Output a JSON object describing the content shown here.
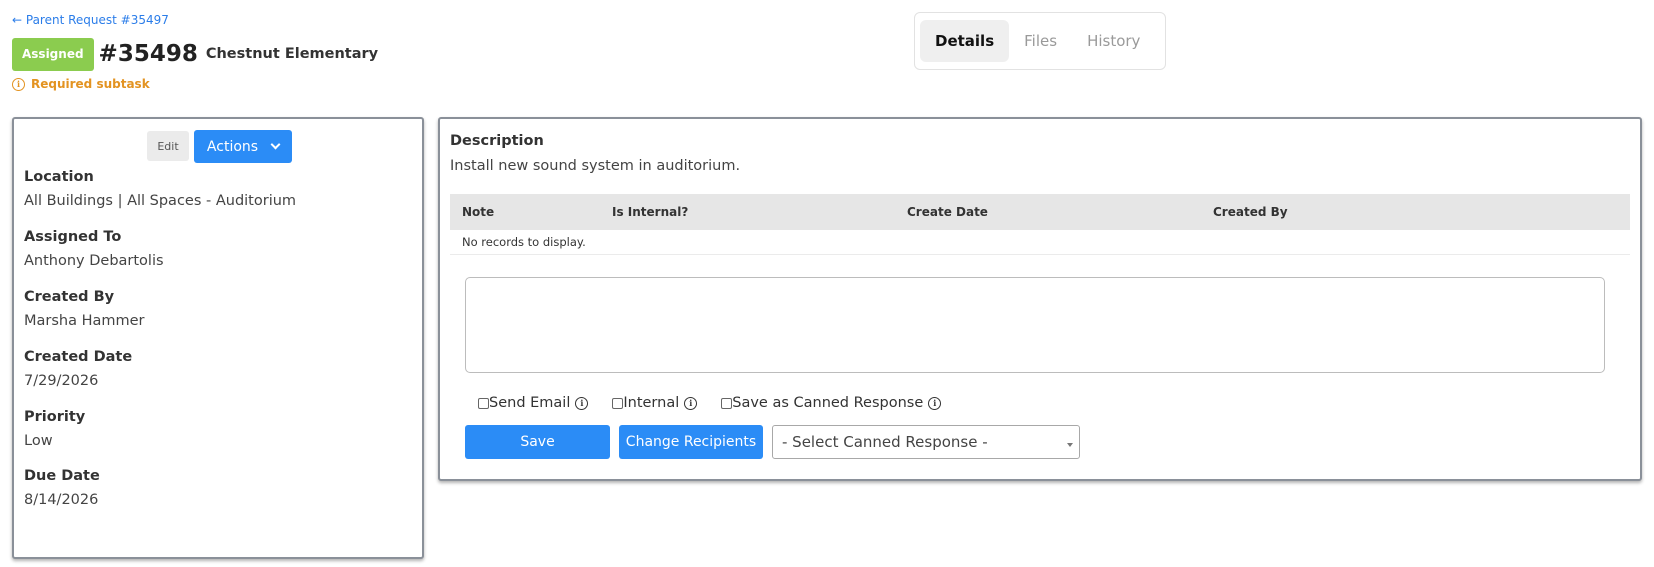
{
  "header": {
    "parent_link": "← Parent Request #35497",
    "status_badge": "Assigned",
    "request_number": "#35498",
    "location_title": "Chestnut Elementary",
    "required_note": "Required subtask"
  },
  "tabs": [
    {
      "label": "Details",
      "active": true
    },
    {
      "label": "Files",
      "active": false
    },
    {
      "label": "History",
      "active": false
    }
  ],
  "left_panel": {
    "edit_label": "Edit",
    "actions_label": "Actions",
    "fields": [
      {
        "label": "Location",
        "value": "All Buildings | All Spaces - Auditorium"
      },
      {
        "label": "Assigned To",
        "value": "Anthony Debartolis"
      },
      {
        "label": "Created By",
        "value": "Marsha Hammer"
      },
      {
        "label": "Created Date",
        "value": "7/29/2026"
      },
      {
        "label": "Priority",
        "value": "Low"
      },
      {
        "label": "Due Date",
        "value": "8/14/2026"
      }
    ]
  },
  "right_panel": {
    "description_label": "Description",
    "description_value": "Install new sound system in auditorium.",
    "notes_table": {
      "columns": [
        "Note",
        "Is Internal?",
        "Create Date",
        "Created By"
      ],
      "empty_message": "No records to display."
    },
    "note_textarea_value": "",
    "options": [
      {
        "label": "Send Email",
        "checked": false
      },
      {
        "label": "Internal",
        "checked": false
      },
      {
        "label": "Save as Canned Response",
        "checked": false
      }
    ],
    "save_label": "Save",
    "change_recipients_label": "Change Recipients",
    "canned_select_value": "- Select Canned Response -"
  },
  "icons": {
    "info": "info-icon",
    "back_arrow": "arrow-left-icon",
    "chevron": "chevron-down-icon",
    "caret": "caret-down-icon"
  },
  "colors": {
    "accent": "#2b8cf6",
    "status_assigned": "#8bcc4f",
    "warning": "#e39321",
    "link": "#2b7de9"
  }
}
